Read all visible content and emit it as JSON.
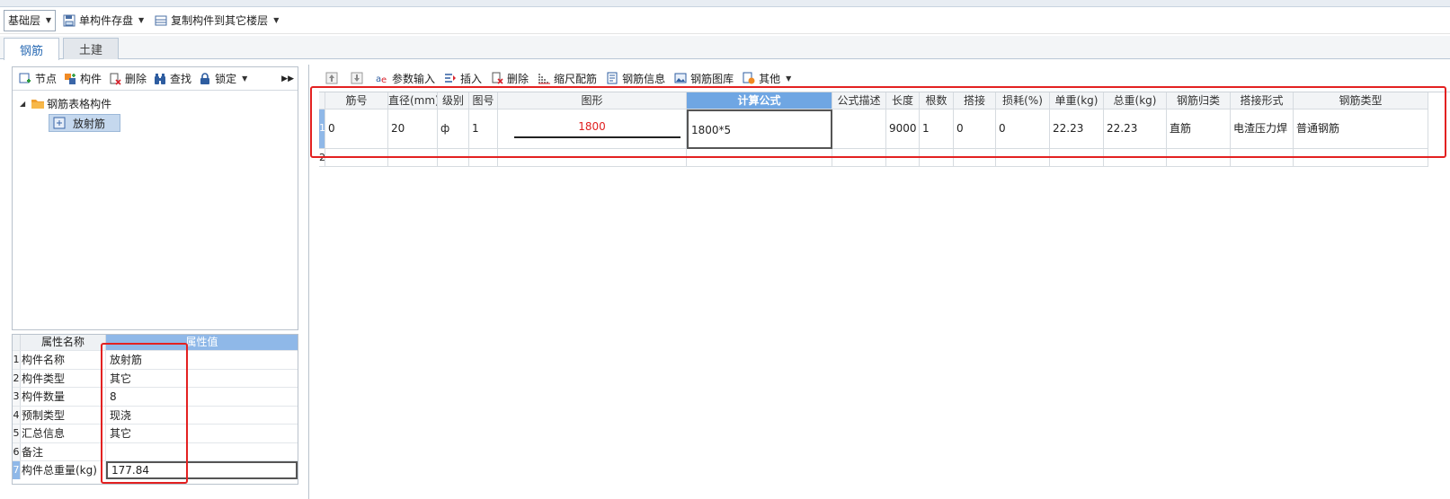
{
  "toolbar": {
    "layer": "基础层",
    "save_single": "单构件存盘",
    "copy_to_floor": "复制构件到其它楼层"
  },
  "tabs": [
    "钢筋",
    "土建"
  ],
  "left_toolbar": {
    "node": "节点",
    "component": "构件",
    "delete": "删除",
    "find": "查找",
    "lock": "锁定"
  },
  "tree": {
    "folder": "钢筋表格构件",
    "item": "放射筋"
  },
  "props": {
    "header_name": "属性名称",
    "header_value": "属性值",
    "rows": [
      {
        "num": "1",
        "name": "构件名称",
        "value": "放射筋"
      },
      {
        "num": "2",
        "name": "构件类型",
        "value": "其它"
      },
      {
        "num": "3",
        "name": "构件数量",
        "value": "8"
      },
      {
        "num": "4",
        "name": "预制类型",
        "value": "现浇"
      },
      {
        "num": "5",
        "name": "汇总信息",
        "value": "其它"
      },
      {
        "num": "6",
        "name": "备注",
        "value": ""
      },
      {
        "num": "7",
        "name": "构件总重量(kg)",
        "value": "177.84"
      }
    ]
  },
  "right_toolbar": {
    "param_input": "参数输入",
    "insert": "插入",
    "delete": "删除",
    "scale_rebar": "缩尺配筋",
    "rebar_info": "钢筋信息",
    "rebar_library": "钢筋图库",
    "other": "其他"
  },
  "grid": {
    "headers": [
      "筋号",
      "直径(mm)",
      "级别",
      "图号",
      "图形",
      "计算公式",
      "公式描述",
      "长度",
      "根数",
      "搭接",
      "损耗(%)",
      "单重(kg)",
      "总重(kg)",
      "钢筋归类",
      "搭接形式",
      "钢筋类型"
    ],
    "row1": {
      "num": "1",
      "bar_no": "0",
      "diameter": "20",
      "grade": "ф",
      "figure_no": "1",
      "shape_len": "1800",
      "formula": "1800*5",
      "formula_desc": "",
      "length": "9000",
      "count": "1",
      "lap": "0",
      "loss": "0",
      "unit_weight": "22.23",
      "total_weight": "22.23",
      "category": "直筋",
      "lap_type": "电渣压力焊",
      "rebar_type": "普通钢筋"
    },
    "row2_num": "2"
  },
  "colors": {
    "selection_blue": "#8fb8e8",
    "header_highlight": "#6fa6e3",
    "annotation_red": "#e32121",
    "shape_label": "#e02020"
  }
}
